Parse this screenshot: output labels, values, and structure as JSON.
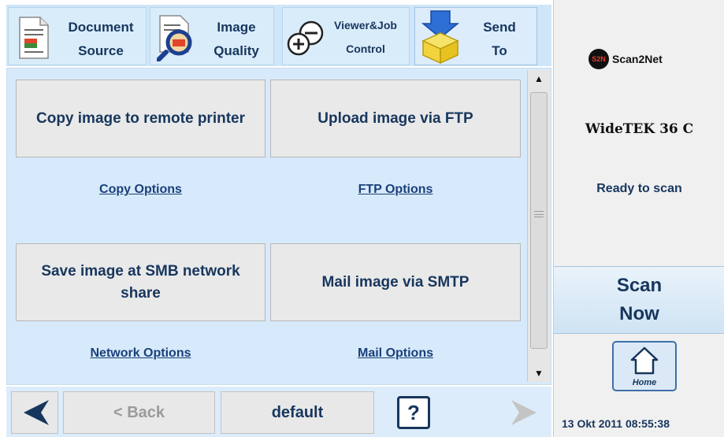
{
  "tabs": [
    {
      "line1": "Document",
      "line2": "Source",
      "icon": "document-icon"
    },
    {
      "line1": "Image",
      "line2": "Quality",
      "icon": "magnifier-icon"
    },
    {
      "line1": "Viewer&Job",
      "line2": "Control",
      "icon": "zoom-plus-minus-icon"
    },
    {
      "line1": "Send",
      "line2": "To",
      "icon": "send-box-icon",
      "active": true
    }
  ],
  "actions": [
    {
      "label": "Copy image to remote printer",
      "link": "Copy Options"
    },
    {
      "label": "Upload image via FTP",
      "link": "FTP Options"
    },
    {
      "label": "Save image at SMB network share",
      "link": "Network Options"
    },
    {
      "label": "Mail image via SMTP",
      "link": "Mail Options"
    }
  ],
  "bottom": {
    "back_label": "< Back",
    "profile_label": "default",
    "help_label": "?"
  },
  "right": {
    "logo_mark": "S2N",
    "logo_text": "Scan2Net",
    "device": "WideTEK 36 C",
    "status": "Ready to scan",
    "scan_line1": "Scan",
    "scan_line2": "Now",
    "home_label": "Home",
    "datetime": "13 Okt 2011 08:55:38"
  },
  "colors": {
    "accent_text": "#17365d",
    "panel_bg": "#d7eafb",
    "nav_arrow": "#17365d"
  }
}
